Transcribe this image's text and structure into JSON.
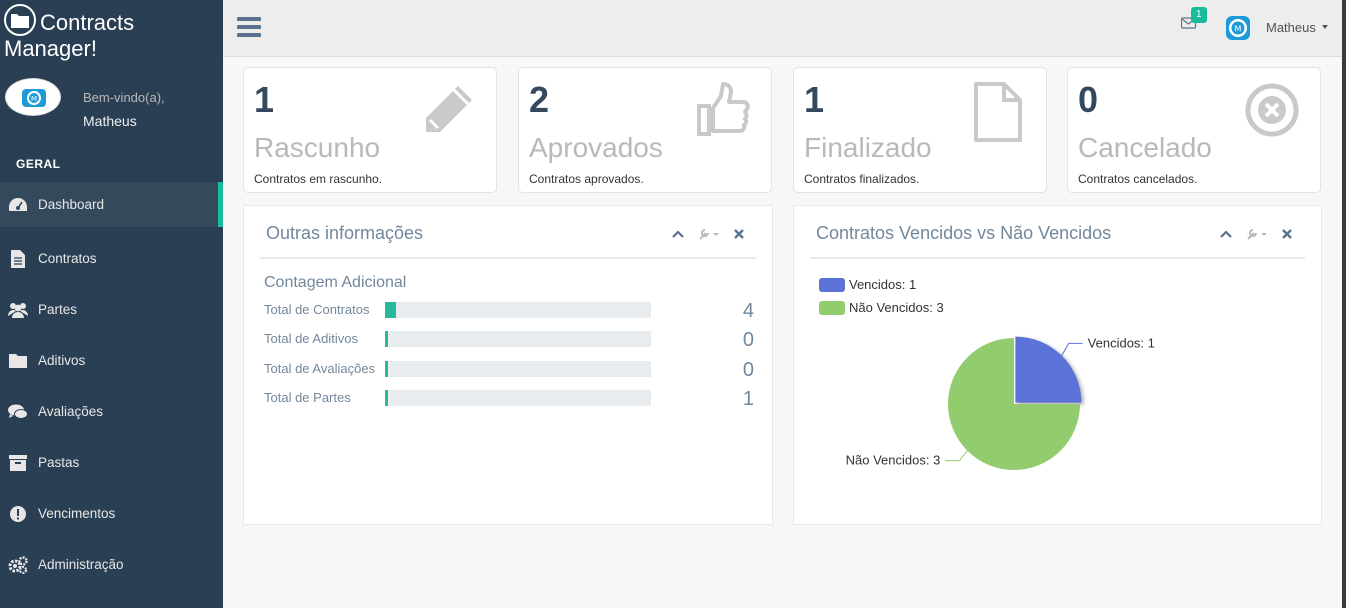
{
  "app": {
    "name_line1": "Contracts",
    "name_line2": "Manager!"
  },
  "profile": {
    "welcome": "Bem-vindo(a),",
    "name": "Matheus"
  },
  "sidebar": {
    "section": "GERAL",
    "items": [
      {
        "label": "Dashboard",
        "icon": "dashboard-icon"
      },
      {
        "label": "Contratos",
        "icon": "file-icon"
      },
      {
        "label": "Partes",
        "icon": "users-icon"
      },
      {
        "label": "Aditivos",
        "icon": "folder-icon"
      },
      {
        "label": "Avaliações",
        "icon": "comments-icon"
      },
      {
        "label": "Pastas",
        "icon": "archive-icon"
      },
      {
        "label": "Vencimentos",
        "icon": "exclamation-icon"
      },
      {
        "label": "Administração",
        "icon": "cogs-icon"
      }
    ]
  },
  "topbar": {
    "mail_count": "1",
    "user": "Matheus"
  },
  "tiles": [
    {
      "count": "1",
      "title": "Rascunho",
      "sub": "Contratos em rascunho.",
      "icon": "pencil-icon"
    },
    {
      "count": "2",
      "title": "Aprovados",
      "sub": "Contratos aprovados.",
      "icon": "thumbs-up-icon"
    },
    {
      "count": "1",
      "title": "Finalizado",
      "sub": "Contratos finalizados.",
      "icon": "file-o-icon"
    },
    {
      "count": "0",
      "title": "Cancelado",
      "sub": "Contratos cancelados.",
      "icon": "times-circle-icon"
    }
  ],
  "info_panel": {
    "title": "Outras informações",
    "subtitle": "Contagem Adicional",
    "rows": [
      {
        "label": "Total de Contratos",
        "value": "4",
        "fill": 0.04
      },
      {
        "label": "Total de Aditivos",
        "value": "0",
        "fill": 0.0
      },
      {
        "label": "Total de Avaliações",
        "value": "0",
        "fill": 0.0
      },
      {
        "label": "Total de Partes",
        "value": "1",
        "fill": 0.01
      }
    ]
  },
  "chart_panel": {
    "title": "Contratos Vencidos vs Não Vencidos"
  },
  "chart_data": {
    "type": "pie",
    "categories": [
      "Vencidos",
      "Não Vencidos"
    ],
    "values": [
      1,
      3
    ],
    "legend": [
      "Vencidos: 1",
      "Não Vencidos: 3"
    ],
    "labels": [
      "Vencidos: 1",
      "Não Vencidos: 3"
    ],
    "colors": [
      "#5B73D6",
      "#93CC6E"
    ],
    "legend_position": "top-left"
  }
}
